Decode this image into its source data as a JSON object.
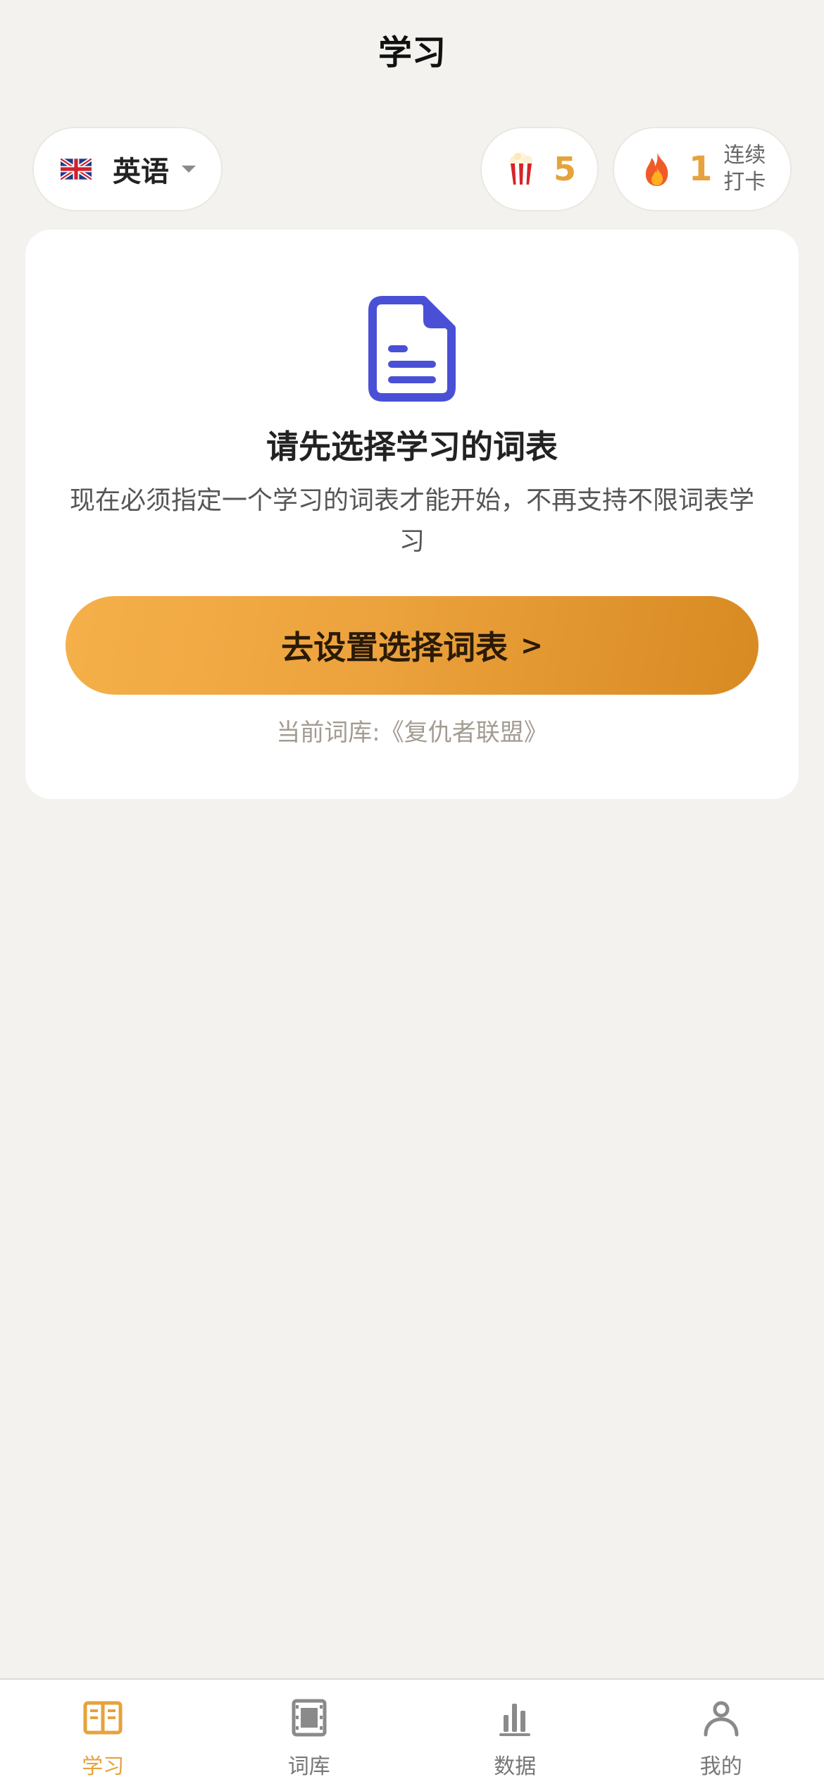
{
  "header": {
    "title": "学习"
  },
  "language_selector": {
    "flag_icon": "uk-flag-icon",
    "label": "英语"
  },
  "popcorn": {
    "icon": "popcorn-icon",
    "count": "5"
  },
  "streak": {
    "icon": "fire-icon",
    "count": "1",
    "label_line1": "连续",
    "label_line2": "打卡"
  },
  "card": {
    "icon": "document-icon",
    "title": "请先选择学习的词表",
    "description": "现在必须指定一个学习的词表才能开始，不再支持不限词表学习",
    "button_label": "去设置选择词表",
    "button_chevron": ">",
    "current_library": "当前词库:《复仇者联盟》"
  },
  "tabs": [
    {
      "label": "学习",
      "icon": "book-icon",
      "active": true
    },
    {
      "label": "词库",
      "icon": "film-icon",
      "active": false
    },
    {
      "label": "数据",
      "icon": "bar-chart-icon",
      "active": false
    },
    {
      "label": "我的",
      "icon": "person-icon",
      "active": false
    }
  ],
  "colors": {
    "accent": "#e6a23c",
    "background": "#f3f2ee",
    "doc_icon": "#4a50d6",
    "inactive_tab": "#777777"
  }
}
